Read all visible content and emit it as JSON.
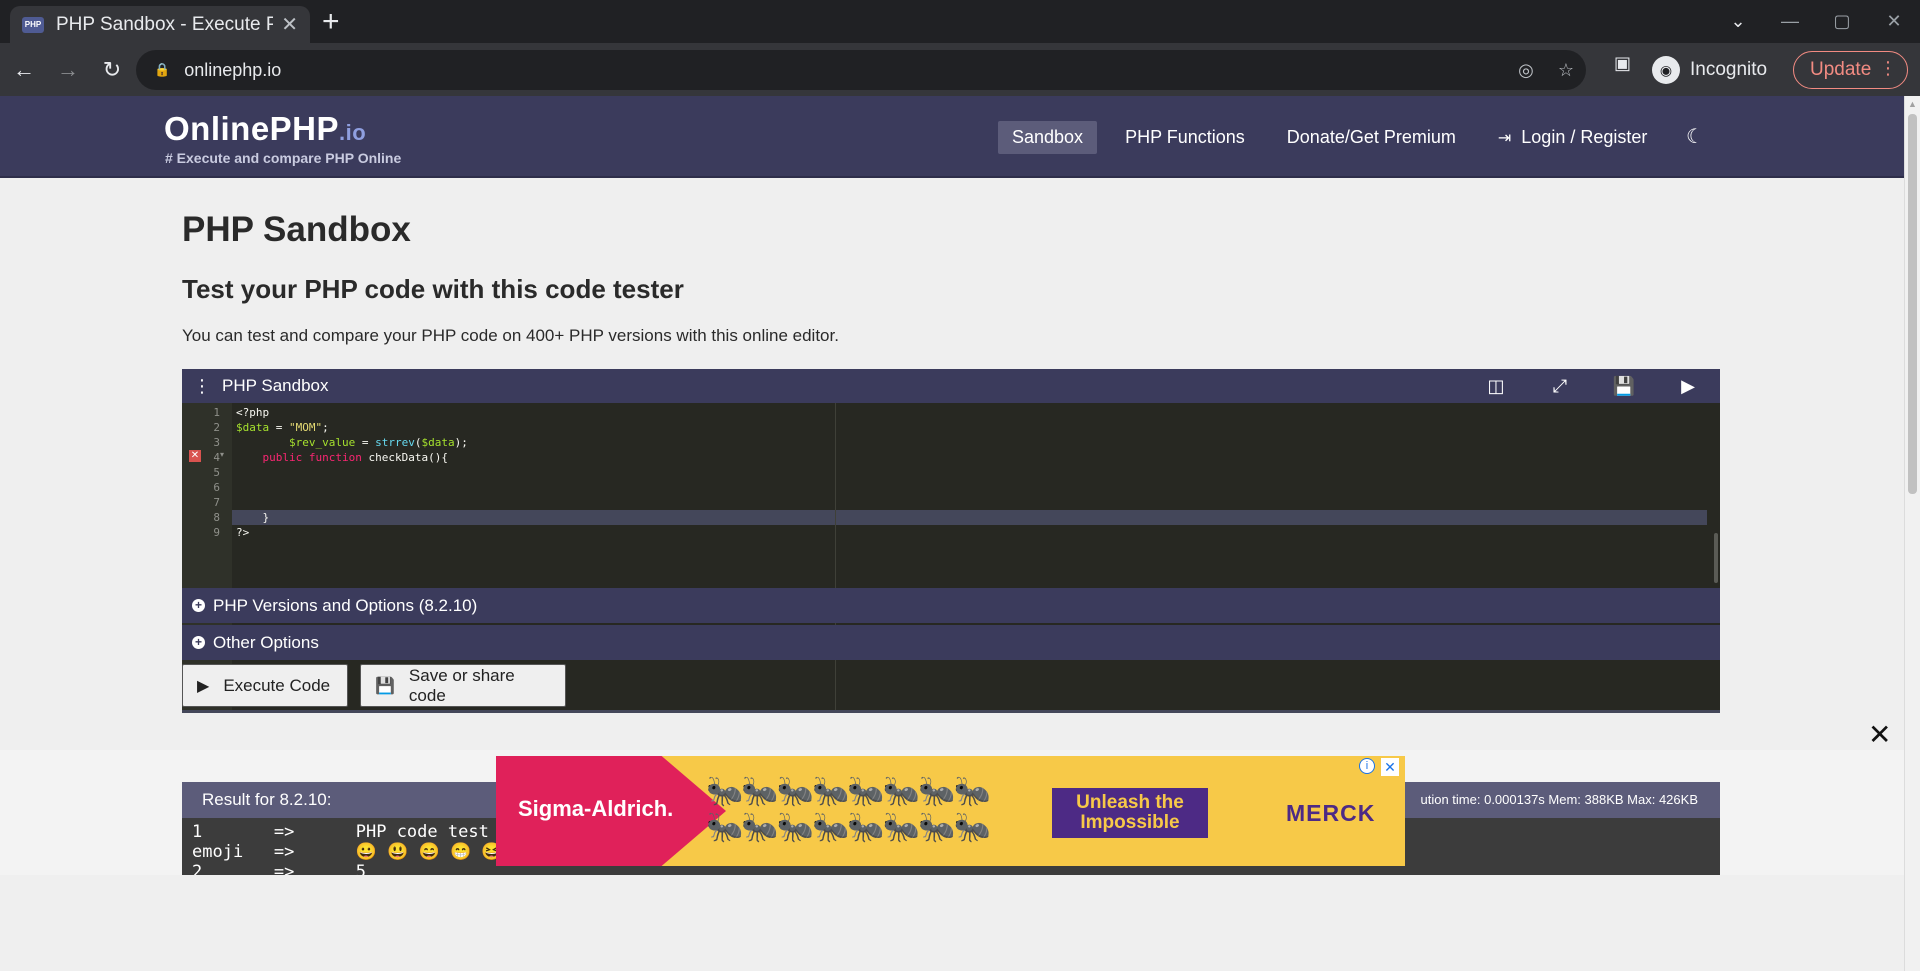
{
  "browser": {
    "tab_title": "PHP Sandbox - Execute PH",
    "url": "onlinephp.io",
    "profile_label": "Incognito",
    "update_label": "Update"
  },
  "site": {
    "logo": "OnlinePHP",
    "logo_suffix": ".io",
    "tagline": "# Execute and compare PHP Online",
    "nav": [
      "Sandbox",
      "PHP Functions",
      "Donate/Get Premium",
      "Login / Register"
    ]
  },
  "page": {
    "title": "PHP Sandbox",
    "subtitle": "Test your PHP code with this code tester",
    "intro": "You can test and compare your PHP code on 400+ PHP versions with this online editor."
  },
  "sandbox": {
    "title": "PHP Sandbox",
    "line_numbers": [
      "1",
      "2",
      "3",
      "4",
      "5",
      "6",
      "7",
      "8",
      "9"
    ],
    "code_lines": [
      "<?php",
      "$data = \"MOM\";",
      "        $rev_value = strrev($data);",
      "    public function checkData(){",
      "",
      "",
      "",
      "    }",
      "?>"
    ]
  },
  "options": {
    "versions_label": "PHP Versions and Options (8.2.10)",
    "other_label": "Other Options"
  },
  "buttons": {
    "execute": "Execute Code",
    "save": "Save or share code"
  },
  "result": {
    "label": "Result for 8.2.10:",
    "meta": "ution time: 0.000137s Mem: 388KB Max: 426KB",
    "output": "1       =>      PHP code test\nemoji   =>      😀 😃 😄 😁 😆\n2       =>      5"
  },
  "ad": {
    "brand": "Sigma-Aldrich.",
    "cta": "Unleash the Impossible",
    "sponsor": "MERCK"
  },
  "icons": {
    "search": "search-icon",
    "play": "play-icon",
    "save": "save-icon"
  }
}
